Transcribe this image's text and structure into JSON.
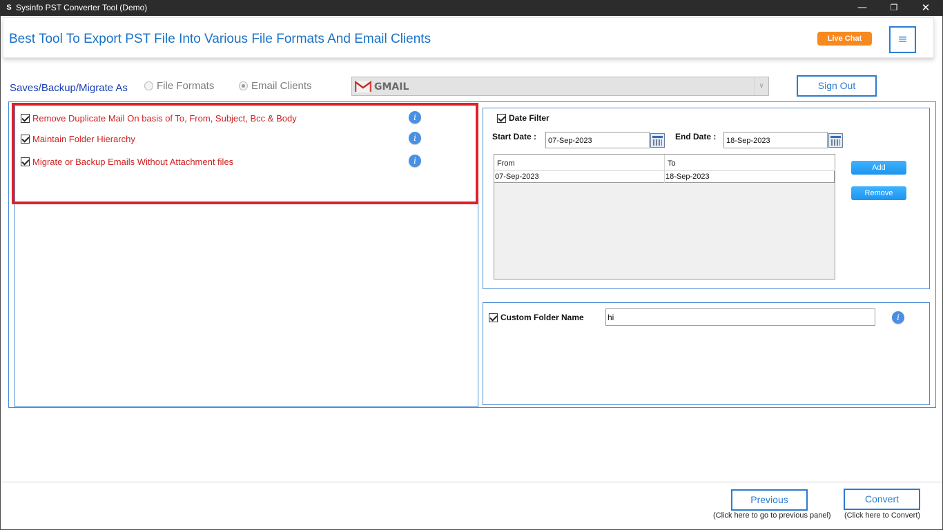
{
  "window": {
    "title": "Sysinfo PST Converter Tool (Demo)",
    "app_icon": "S",
    "minimize": "—",
    "maximize": "❐",
    "close": "✕"
  },
  "header": {
    "heading": "Best Tool To Export PST File Into Various File Formats And Email Clients",
    "live_chat": "Live Chat",
    "menu_icon": "≡"
  },
  "saves": {
    "label": "Saves/Backup/Migrate As",
    "file_formats": "File Formats",
    "email_clients": "Email Clients",
    "selected": "Email Clients",
    "client_value": "GMAIL",
    "dropdown_arrow": "∨"
  },
  "sign_out": "Sign Out",
  "options": [
    {
      "label": "Remove Duplicate Mail On basis of To, From, Subject, Bcc & Body",
      "checked": true
    },
    {
      "label": "Maintain Folder Hierarchy",
      "checked": true
    },
    {
      "label": "Migrate or Backup Emails Without Attachment files",
      "checked": true
    }
  ],
  "info_glyph": "i",
  "date_filter": {
    "label": "Date Filter",
    "checked": true,
    "start_label": "Start Date :",
    "start_value": "07-Sep-2023",
    "end_label": "End Date :",
    "end_value": "18-Sep-2023",
    "columns": [
      "From",
      "To"
    ],
    "rows": [
      [
        "07-Sep-2023",
        "18-Sep-2023"
      ]
    ],
    "add": "Add",
    "remove": "Remove"
  },
  "custom_folder": {
    "label": "Custom Folder Name",
    "checked": true,
    "value": "hi"
  },
  "footer": {
    "previous": "Previous",
    "previous_hint": "(Click here to go to previous panel)",
    "convert": "Convert",
    "convert_hint": "(Click here to Convert)"
  },
  "colors": {
    "accent": "#2b7bd0",
    "heading": "#1a73c7",
    "option_text": "#d02020",
    "highlight_box": "#e02028",
    "live_chat": "#f7891e"
  }
}
